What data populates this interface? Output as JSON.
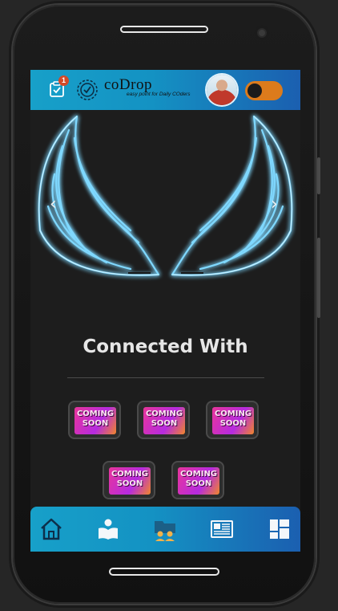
{
  "header": {
    "notification_count": "1",
    "brand_name": "coDrop",
    "brand_tagline": "easy point for Daily COders",
    "theme_toggle": "dark"
  },
  "carousel": {
    "prev_label": "‹",
    "next_label": "›",
    "slide_count": 2,
    "active_slide": 1
  },
  "connected": {
    "heading": "Connected With",
    "partners": [
      {
        "line1": "COMING",
        "line2": "SOON"
      },
      {
        "line1": "COMING",
        "line2": "SOON"
      },
      {
        "line1": "COMING",
        "line2": "SOON"
      },
      {
        "line1": "COMING",
        "line2": "SOON"
      },
      {
        "line1": "COMING",
        "line2": "SOON"
      }
    ]
  },
  "bottom_nav": {
    "items": [
      "home-icon",
      "reader-icon",
      "community-icon",
      "news-icon",
      "dashboard-icon"
    ],
    "active_index": 2
  },
  "colors": {
    "bar_start": "#17a0c9",
    "bar_end": "#1b5fb0",
    "toggle": "#dc7b1c",
    "glow": "#6fd2ff"
  }
}
